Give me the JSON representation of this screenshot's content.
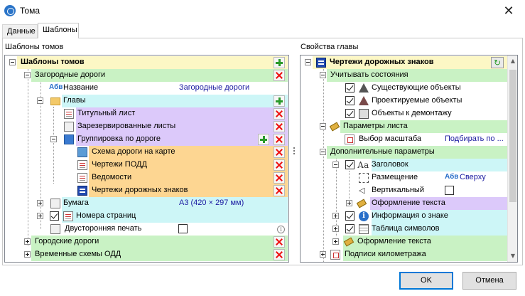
{
  "window": {
    "title": "Тома",
    "close_glyph": "✕"
  },
  "tabs": [
    {
      "label": "Данные"
    },
    {
      "label": "Шаблоны"
    }
  ],
  "left_panel": {
    "heading": "Шаблоны томов",
    "rows": {
      "root": "Шаблоны томов",
      "zagorodnye": "Загородные дороги",
      "nazvanie_label": "Название",
      "nazvanie_value": "Загородные дороги",
      "glavy": "Главы",
      "titul": "Титульный лист",
      "reserv": "Зарезервированные листы",
      "gruppa": "Группировка по дороге",
      "schema": "Схема дороги на карте",
      "podd": "Чертежи ПОДД",
      "vedom": "Ведомости",
      "znaki": "Чертежи дорожных знаков",
      "bumaga_label": "Бумага",
      "bumaga_value": "А3 (420 × 297 мм)",
      "nomera": "Номера страниц",
      "dvustor": "Двусторонняя печать",
      "gorod": "Городские дороги",
      "vremen": "Временные схемы ОДД"
    }
  },
  "right_panel": {
    "heading": "Свойства главы",
    "rows": {
      "root": "Чертежи дорожных знаков",
      "uchit": "Учитывать состояния",
      "suschest": "Существующие объекты",
      "proekt": "Проектируемые объекты",
      "demont": "Объекты к демонтажу",
      "param_lista": "Параметры листа",
      "vybor_label": "Выбор масштаба",
      "vybor_value": "Подбирать по ...",
      "dop_param": "Дополнительные параметры",
      "zagolovok": "Заголовок",
      "razmesch_label": "Размещение",
      "razmesch_value": "Сверху",
      "vertik": "Вертикальный",
      "oform1": "Оформление текста",
      "info_znak": "Информация о знаке",
      "tabl_simv": "Таблица символов",
      "oform2": "Оформление текста",
      "podpisi": "Подписи километража"
    }
  },
  "icons": {
    "abc_text": "Абв",
    "aa_text": "Аа",
    "info_text": "i",
    "vert_text": "◁",
    "refresh_glyph": "↻",
    "scroll_up": "▲",
    "scroll_down": "▼"
  },
  "footer": {
    "ok": "OK",
    "cancel": "Отмена"
  },
  "colors": {
    "yellow": "#fcf7c5",
    "green": "#c9f2c4",
    "cyan": "#cdf6f7",
    "purple": "#dcc9fa",
    "orange": "#fdd692"
  }
}
